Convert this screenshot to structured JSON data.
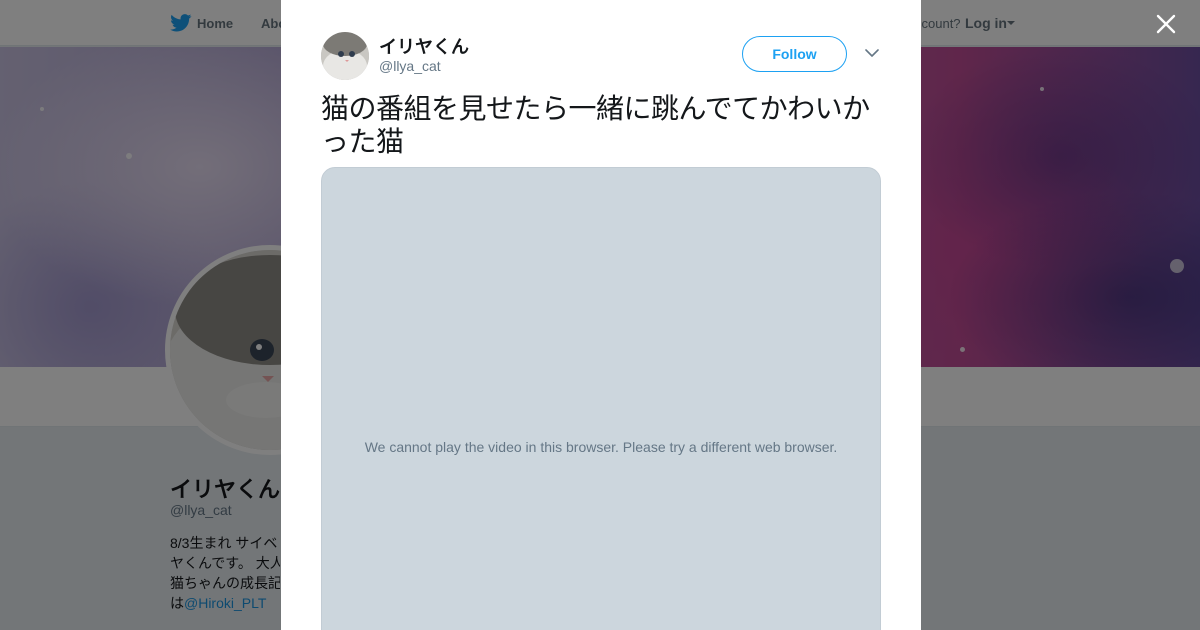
{
  "nav": {
    "home_label": "Home",
    "about_label": "Abo",
    "account_text": "ccount?",
    "login_label": "Log in"
  },
  "profile": {
    "name": "イリヤくん",
    "handle": "@llya_cat",
    "bio_lines": [
      "8/3生まれ サイベ",
      "ヤくんです。 大人",
      "猫ちゃんの成長記"
    ],
    "bio_last_prefix": "は",
    "bio_mention": "@Hiroki_PLT"
  },
  "tweet": {
    "author_name": "イリヤくん",
    "author_handle": "@llya_cat",
    "follow_label": "Follow",
    "text": "猫の番組を見せたら一緒に跳んでてかわいかった猫",
    "video_message": "We cannot play the video in this browser. Please try a different web browser."
  },
  "colors": {
    "brand_blue": "#1da1f2",
    "link_blue": "#1b95e0",
    "video_placeholder": "#ccd6dd",
    "secondary_text": "#657786"
  },
  "icons": {
    "nav_logo": "twitter-bird-icon",
    "close": "close-icon",
    "more": "chevron-down-icon",
    "login_dropdown": "caret-down-icon"
  }
}
